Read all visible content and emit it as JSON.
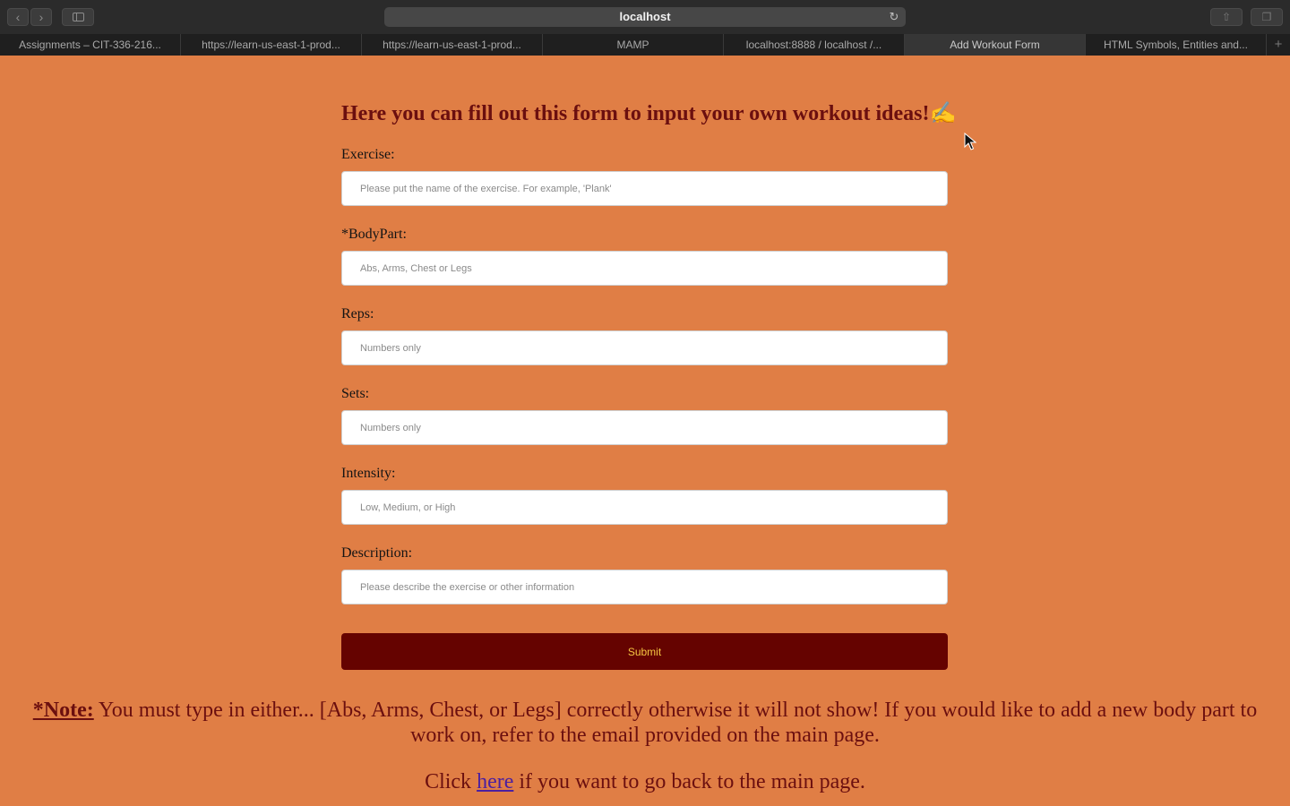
{
  "browser": {
    "url": "localhost",
    "reload_icon": "↻",
    "tabs": [
      {
        "label": "Assignments – CIT-336-216...",
        "active": false
      },
      {
        "label": "https://learn-us-east-1-prod...",
        "active": false
      },
      {
        "label": "https://learn-us-east-1-prod...",
        "active": false
      },
      {
        "label": "MAMP",
        "active": false
      },
      {
        "label": "localhost:8888 / localhost /...",
        "active": false
      },
      {
        "label": "Add Workout Form",
        "active": true
      },
      {
        "label": "HTML Symbols, Entities and...",
        "active": false
      }
    ],
    "new_tab": "+"
  },
  "form": {
    "title": "Here you can fill out this form to input your own workout ideas!✍",
    "fields": [
      {
        "label": "Exercise:",
        "placeholder": "Please put the name of the exercise. For example, 'Plank'"
      },
      {
        "label": "*BodyPart:",
        "placeholder": "Abs, Arms, Chest or Legs"
      },
      {
        "label": "Reps:",
        "placeholder": "Numbers only"
      },
      {
        "label": "Sets:",
        "placeholder": "Numbers only"
      },
      {
        "label": "Intensity:",
        "placeholder": "Low, Medium, or High"
      },
      {
        "label": "Description:",
        "placeholder": "Please describe the exercise or other information"
      }
    ],
    "submit_label": "Submit"
  },
  "note": {
    "label": "*Note:",
    "text": " You must type in either... [Abs, Arms, Chest, or Legs] correctly otherwise it will not show! If you would like to add a new body part to work on, refer to the email provided on the main page."
  },
  "back": {
    "before": "Click ",
    "link": "here",
    "after": " if you want to go back to the main page."
  },
  "colors": {
    "page_background": "#e07e45",
    "title": "#6b0f0f",
    "submit_background": "#650300",
    "submit_text": "#f5c542",
    "link": "#4b1fa0"
  }
}
